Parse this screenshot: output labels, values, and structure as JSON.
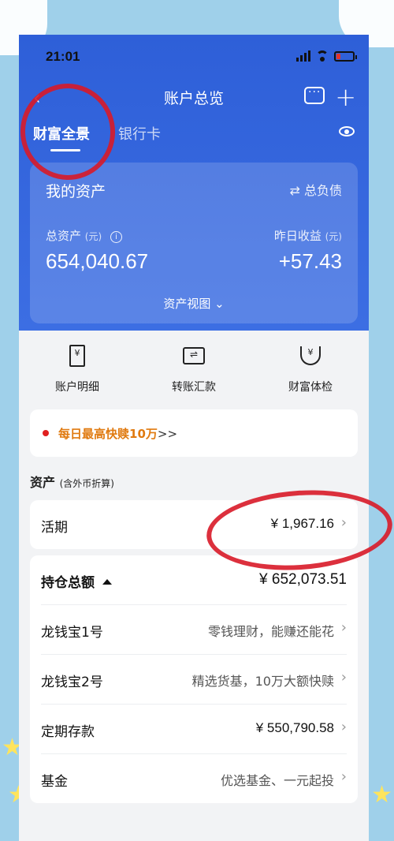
{
  "status": {
    "time": "21:01"
  },
  "nav": {
    "title": "账户总览"
  },
  "tabs": [
    {
      "label": "财富全景"
    },
    {
      "label": "银行卡"
    }
  ],
  "asset_card": {
    "title": "我的资产",
    "debt_link": "⇄ 总负债",
    "total_label": "总资产",
    "total_unit": "(元)",
    "total_value": "654,040.67",
    "yday_label": "昨日收益",
    "yday_unit": "(元)",
    "yday_value": "+57.43",
    "view_label": "资产视图 ⌄"
  },
  "quick_actions": [
    {
      "label": "账户明细",
      "icon": "receipt-yen-icon"
    },
    {
      "label": "转账汇款",
      "icon": "transfer-icon"
    },
    {
      "label": "财富体检",
      "icon": "stethoscope-icon"
    }
  ],
  "promo": {
    "text": "每日最高快赎10万",
    "arrow": ">>"
  },
  "section": {
    "title": "资产",
    "subtitle": "(含外币折算)"
  },
  "current": {
    "label": "活期",
    "value": "¥ 1,967.16"
  },
  "holdings": {
    "label": "持仓总额",
    "value": "¥ 652,073.51",
    "items": [
      {
        "label": "龙钱宝1号",
        "value": "零钱理财，能赚还能花"
      },
      {
        "label": "龙钱宝2号",
        "value": "精选货基，10万大额快赎"
      },
      {
        "label": "定期存款",
        "value": "¥ 550,790.58"
      },
      {
        "label": "基金",
        "value": "优选基金、一元起投"
      }
    ]
  },
  "colors": {
    "primary": "#3465dd",
    "accent_orange": "#e07a10",
    "annotation_red": "#d81a28"
  }
}
